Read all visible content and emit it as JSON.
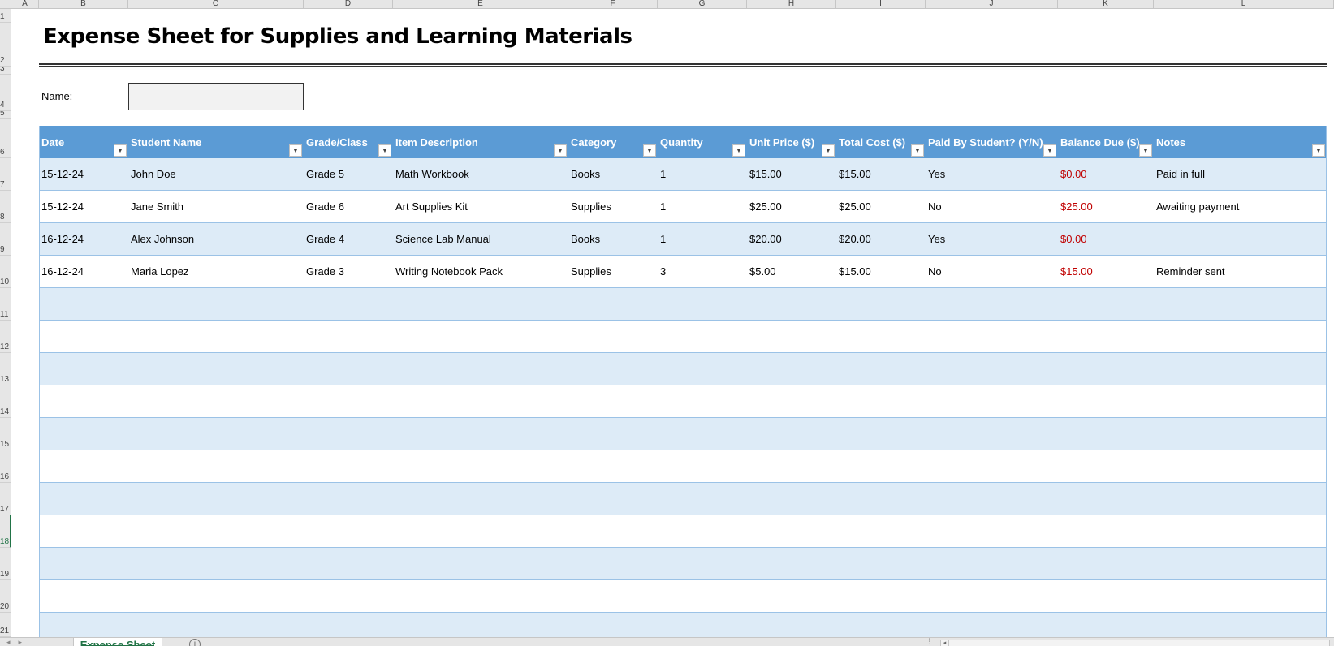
{
  "spreadsheet": {
    "column_letters": [
      "A",
      "B",
      "C",
      "D",
      "E",
      "F",
      "G",
      "H",
      "I",
      "J",
      "K",
      "L"
    ],
    "row_numbers": [
      "1",
      "2",
      "3",
      "4",
      "5",
      "6",
      "7",
      "8",
      "9",
      "10",
      "11",
      "12",
      "13",
      "14",
      "15",
      "16",
      "17",
      "18",
      "19",
      "20",
      "21"
    ],
    "active_row": "18"
  },
  "sheet": {
    "title": "Expense Sheet for Supplies and Learning Materials",
    "name_label": "Name:",
    "name_value": ""
  },
  "table": {
    "headers": [
      "Date",
      "Student Name",
      "Grade/Class",
      "Item Description",
      "Category",
      "Quantity",
      "Unit Price ($)",
      "Total Cost ($)",
      "Paid By Student? (Y/N)",
      "Balance Due ($)",
      "Notes"
    ],
    "filter_icon": "dropdown-arrow-icon",
    "rows": [
      [
        "15-12-24",
        "John Doe",
        "Grade 5",
        "Math Workbook",
        "Books",
        "1",
        "$15.00",
        "$15.00",
        "Yes",
        "$0.00",
        "Paid in full"
      ],
      [
        "15-12-24",
        "Jane Smith",
        "Grade 6",
        "Art Supplies Kit",
        "Supplies",
        "1",
        "$25.00",
        "$25.00",
        "No",
        "$25.00",
        "Awaiting payment"
      ],
      [
        "16-12-24",
        "Alex Johnson",
        "Grade 4",
        "Science Lab Manual",
        "Books",
        "1",
        "$20.00",
        "$20.00",
        "Yes",
        "$0.00",
        ""
      ],
      [
        "16-12-24",
        "Maria Lopez",
        "Grade 3",
        "Writing Notebook Pack",
        "Supplies",
        "3",
        "$5.00",
        "$15.00",
        "No",
        "$15.00",
        "Reminder sent"
      ]
    ],
    "empty_row_count": 11,
    "colors": {
      "header_bg": "#5b9bd5",
      "band_bg": "#ddebf7",
      "balance_due_text": "#c00000"
    }
  },
  "tabs": {
    "sheets": [
      "Expense Sheet"
    ],
    "active": "Expense Sheet",
    "add_sheet_icon": "plus-circle-icon"
  }
}
